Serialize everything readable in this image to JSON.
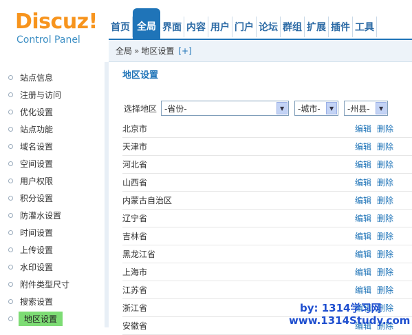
{
  "header": {
    "logo": "Discuz!",
    "logo_sub": "Control Panel",
    "nav": [
      {
        "label": "首页",
        "active": false
      },
      {
        "label": "全局",
        "active": true
      },
      {
        "label": "界面",
        "active": false
      },
      {
        "label": "内容",
        "active": false
      },
      {
        "label": "用户",
        "active": false
      },
      {
        "label": "门户",
        "active": false
      },
      {
        "label": "论坛",
        "active": false
      },
      {
        "label": "群组",
        "active": false
      },
      {
        "label": "扩展",
        "active": false
      },
      {
        "label": "插件",
        "active": false
      },
      {
        "label": "工具",
        "active": false
      }
    ]
  },
  "breadcrumb": {
    "root": "全局",
    "sep": "»",
    "current": "地区设置",
    "add": "[+]"
  },
  "sidebar": {
    "items": [
      "站点信息",
      "注册与访问",
      "优化设置",
      "站点功能",
      "域名设置",
      "空间设置",
      "用户权限",
      "积分设置",
      "防灌水设置",
      "时间设置",
      "上传设置",
      "水印设置",
      "附件类型尺寸",
      "搜索设置",
      "地区设置"
    ],
    "active_index": 14
  },
  "main": {
    "title": "地区设置",
    "filter_label": "选择地区",
    "province": "-省份-",
    "city": "-城市-",
    "county": "-州县-",
    "edit_label": "编辑",
    "delete_label": "删除",
    "regions": [
      "北京市",
      "天津市",
      "河北省",
      "山西省",
      "内蒙古自治区",
      "辽宁省",
      "吉林省",
      "黑龙江省",
      "上海市",
      "江苏省",
      "浙江省",
      "安徽省"
    ]
  },
  "watermark": {
    "line1": "by: 1314学习网",
    "line2": "www.1314Study.com"
  }
}
